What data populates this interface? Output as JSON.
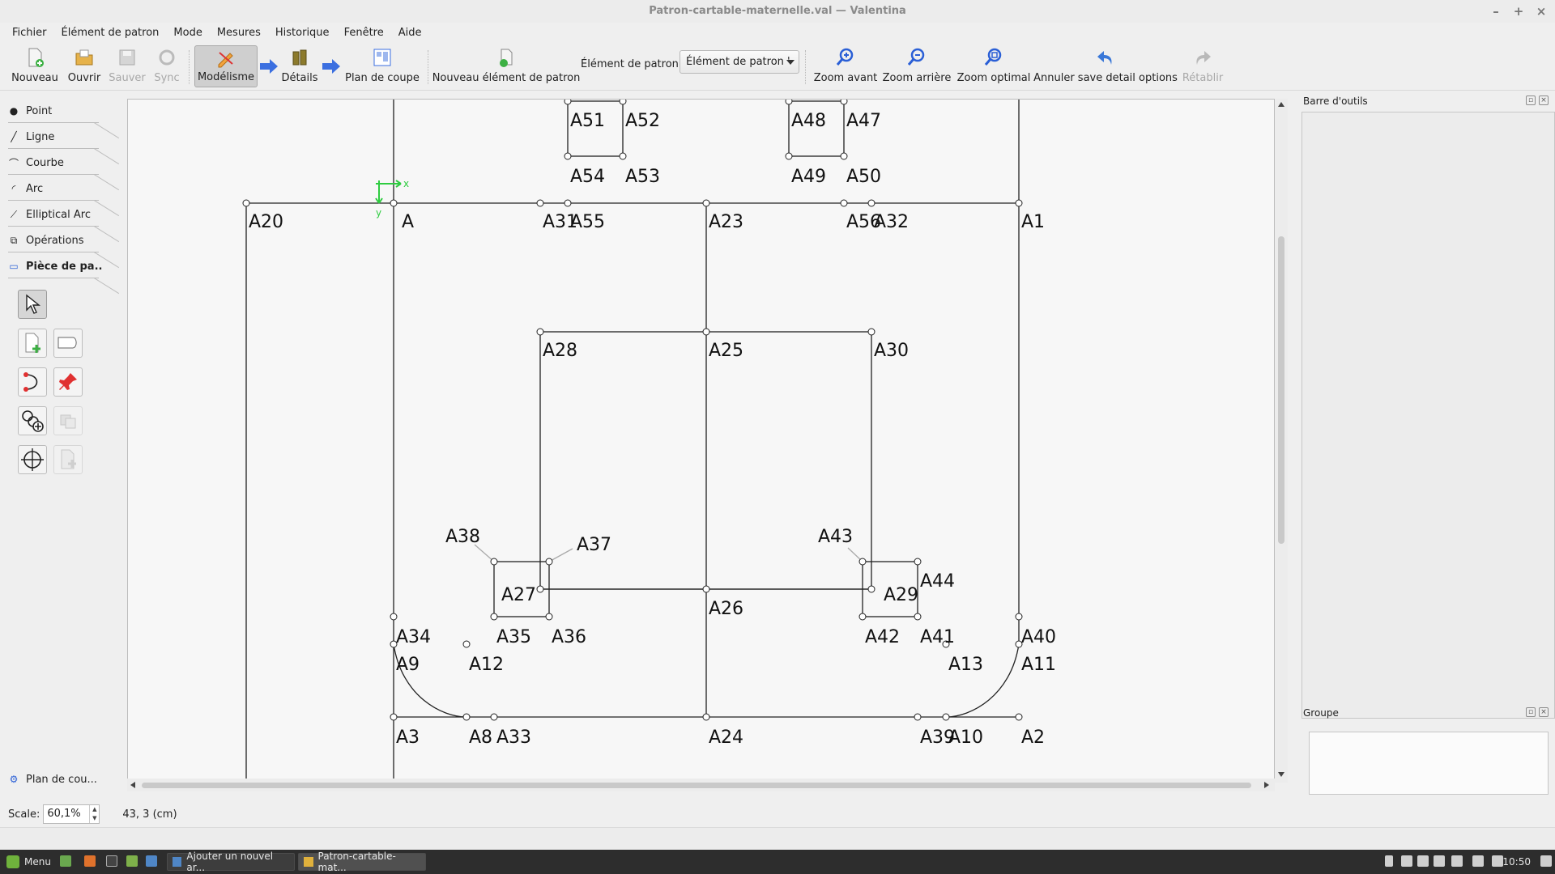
{
  "window": {
    "title": "Patron-cartable-maternelle.val — Valentina",
    "controls": [
      "–",
      "+",
      "×"
    ]
  },
  "menu": [
    "Fichier",
    "Élément de patron",
    "Mode",
    "Mesures",
    "Historique",
    "Fenêtre",
    "Aide"
  ],
  "toolbar": {
    "new": "Nouveau",
    "open": "Ouvrir",
    "save": "Sauver",
    "sync": "Sync",
    "draft": "Modélisme",
    "details": "Détails",
    "layout": "Plan de coupe",
    "new_piece": "Nouveau élément de patron",
    "piece_label": "Élément de patron :",
    "piece_value": "Élément de patron '",
    "zoom_in": "Zoom avant",
    "zoom_out": "Zoom arrière",
    "zoom_fit": "Zoom optimal",
    "undo": "Annuler save detail options",
    "redo": "Rétablir"
  },
  "tool_categories": [
    "Point",
    "Ligne",
    "Courbe",
    "Arc",
    "Elliptical Arc",
    "Opérations",
    "Pièce de pa..",
    "Plan de cou..."
  ],
  "tool_icons": [
    "arrow-pointer-icon",
    "add-piece-icon",
    "detail-shape-icon",
    "curve-path-icon",
    "pin-icon",
    "link-node-icon",
    "union-icon",
    "crosshair-icon",
    "piece-duplicate-icon"
  ],
  "dock": {
    "toolbox_title": "Barre d'outils",
    "group_title": "Groupe"
  },
  "status": {
    "scale_label": "Scale:",
    "scale_value": "60,1%",
    "coords": "43, 3 (cm)"
  },
  "canvas": {
    "axis_x": "x",
    "axis_y": "y"
  },
  "points": [
    "A",
    "A1",
    "A2",
    "A3",
    "A8",
    "A9",
    "A10",
    "A11",
    "A12",
    "A13",
    "A20",
    "A23",
    "A24",
    "A25",
    "A26",
    "A27",
    "A28",
    "A29",
    "A30",
    "A31",
    "A32",
    "A33",
    "A34",
    "A35",
    "A36",
    "A37",
    "A38",
    "A39",
    "A40",
    "A41",
    "A42",
    "A43",
    "A44",
    "A47",
    "A48",
    "A49",
    "A50",
    "A51",
    "A52",
    "A53",
    "A54",
    "A55",
    "A56"
  ],
  "taskbar": {
    "menu": "Menu",
    "windows": [
      "Ajouter un nouvel ar...",
      "Patron-cartable-mat..."
    ],
    "clock": "10:50"
  }
}
